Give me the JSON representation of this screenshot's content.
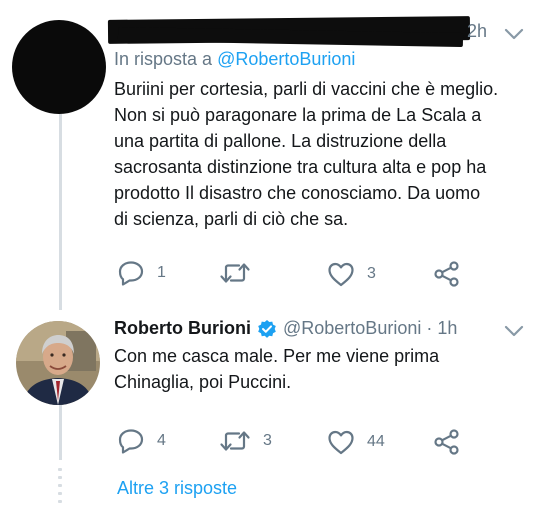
{
  "tweet1": {
    "time": "2h",
    "reply_prefix": "In risposta a",
    "reply_handle": "@RobertoBurioni",
    "text_lines": [
      "Buriini per cortesia, parli di vaccini che è meglio.",
      "Non si può paragonare la prima de La Scala a",
      "una partita di pallone. La distruzione della",
      "sacrosanta distinzione tra cultura alta e pop ha",
      "prodotto Il disastro che conosciamo. Da uomo",
      "di scienza, parli di ciò che sa."
    ],
    "reply_count": "1",
    "retweet_count": "",
    "like_count": "3"
  },
  "tweet2": {
    "name": "Roberto Burioni",
    "handle": "@RobertoBurioni",
    "separator": "·",
    "time": "1h",
    "text_lines": [
      "Con me casca male. Per me viene prima",
      "Chinaglia, poi Puccini."
    ],
    "reply_count": "4",
    "retweet_count": "3",
    "like_count": "44"
  },
  "more_replies": "Altre 3 risposte",
  "icons": {
    "reply": "reply-icon",
    "retweet": "retweet-icon",
    "like": "heart-icon",
    "share": "share-icon",
    "verified": "verified-badge-icon",
    "menu": "chevron-down-icon"
  },
  "colors": {
    "accent": "#1da1f2",
    "secondary_text": "#657786",
    "primary_text": "#14171a"
  }
}
